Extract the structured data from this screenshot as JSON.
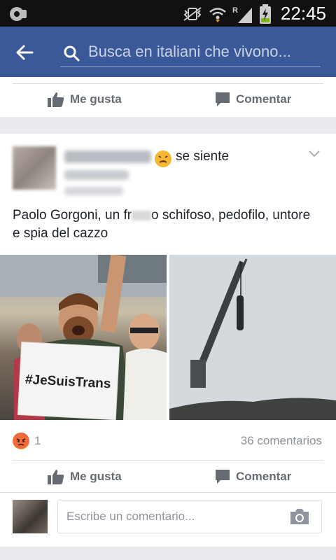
{
  "status_bar": {
    "time": "22:45",
    "icons": [
      "android-debug-icon",
      "vibrate-icon",
      "wifi-icon",
      "roaming-signal-icon",
      "battery-charging-icon"
    ]
  },
  "header": {
    "back_icon": "arrow-left-icon",
    "search_placeholder": "Busca en italiani che vivono..."
  },
  "prev_post": {
    "like_label": "Me gusta",
    "comment_label": "Comentar"
  },
  "post": {
    "feeling_text": "se siente",
    "text_before": "Paolo Gorgoni, un fr",
    "text_after": "o schifoso, pedofilo, untore e spia del cazzo",
    "photo1_sign_text": "#JeSuisTrans",
    "reaction_count": "1",
    "comments_count": "36 comentarios",
    "like_label": "Me gusta",
    "comment_label": "Comentar",
    "comment_placeholder": "Escribe un comentario..."
  },
  "colors": {
    "brand": "#3b5998",
    "background": "#e9ebee",
    "secondary_text": "#90949c"
  }
}
